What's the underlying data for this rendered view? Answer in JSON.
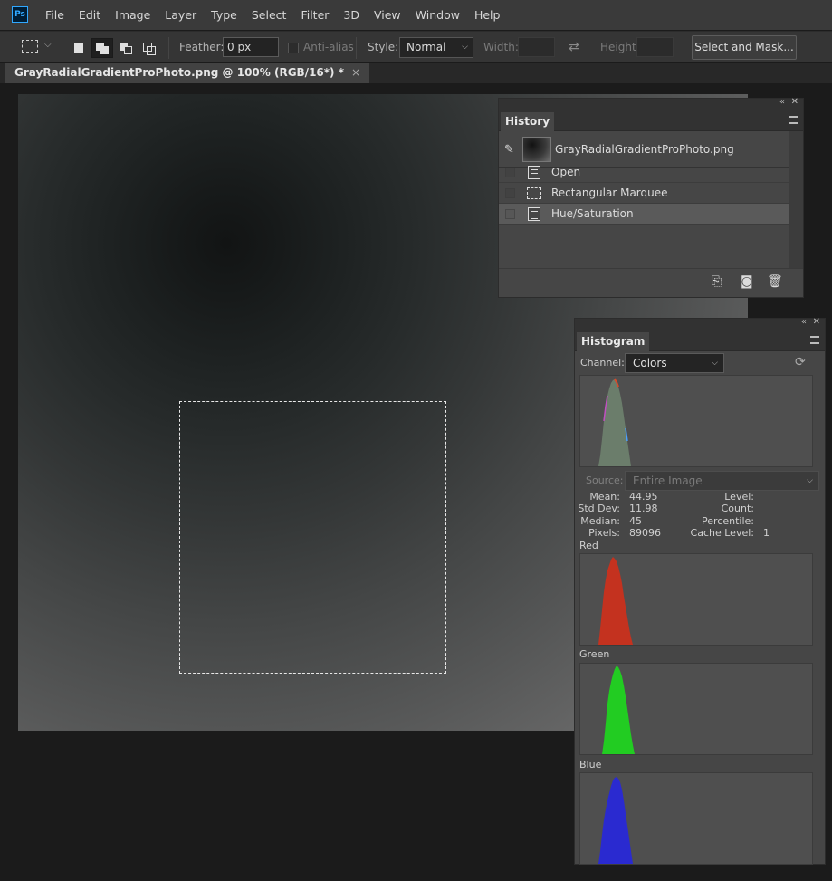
{
  "menubar": {
    "logo": "Ps",
    "items": [
      "File",
      "Edit",
      "Image",
      "Layer",
      "Type",
      "Select",
      "Filter",
      "3D",
      "View",
      "Window",
      "Help"
    ]
  },
  "options": {
    "feather_label": "Feather:",
    "feather_value": "0 px",
    "antialias_label": "Anti-alias",
    "style_label": "Style:",
    "style_value": "Normal",
    "width_label": "Width:",
    "height_label": "Height:",
    "select_mask_label": "Select and Mask..."
  },
  "document": {
    "tab_title": "GrayRadialGradientProPhoto.png @ 100% (RGB/16*) *",
    "close": "×"
  },
  "history": {
    "tab": "History",
    "snapshot_name": "GrayRadialGradientProPhoto.png",
    "items": [
      {
        "label": "Open",
        "icon": "document-icon"
      },
      {
        "label": "Rectangular Marquee",
        "icon": "marquee-icon"
      },
      {
        "label": "Hue/Saturation",
        "icon": "document-icon",
        "selected": true
      }
    ]
  },
  "histogram": {
    "tab": "Histogram",
    "channel_label": "Channel:",
    "channel_value": "Colors",
    "source_label": "Source:",
    "source_value": "Entire Image",
    "stats": {
      "mean_label": "Mean:",
      "mean": "44.95",
      "stddev_label": "Std Dev:",
      "stddev": "11.98",
      "median_label": "Median:",
      "median": "45",
      "pixels_label": "Pixels:",
      "pixels": "89096",
      "level_label": "Level:",
      "level": "",
      "count_label": "Count:",
      "count": "",
      "percentile_label": "Percentile:",
      "percentile": "",
      "cache_label": "Cache Level:",
      "cache": "1"
    },
    "channels": [
      {
        "name": "Red",
        "color": "#c4321f"
      },
      {
        "name": "Green",
        "color": "#22cc22"
      },
      {
        "name": "Blue",
        "color": "#2a2ad0"
      }
    ],
    "composite_color": "#6b7d6b"
  }
}
